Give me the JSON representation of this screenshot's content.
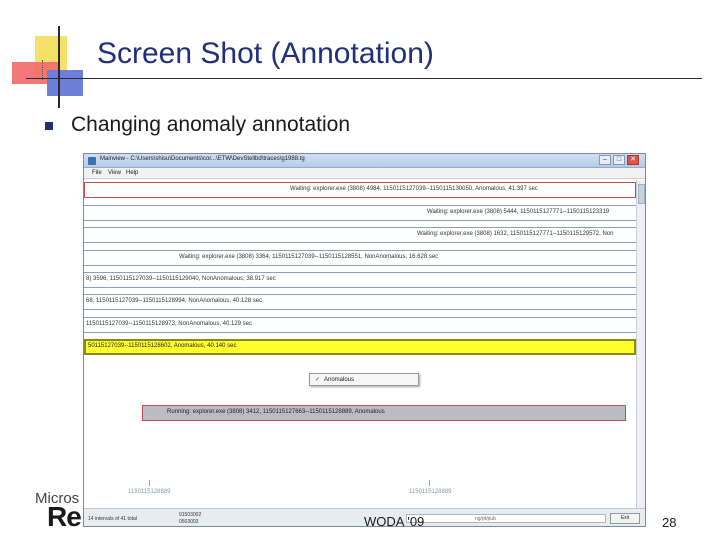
{
  "slide": {
    "title": "Screen Shot (Annotation)",
    "bullet": "Changing anomaly annotation",
    "footer": "WODA '09",
    "page_number": "28",
    "logo_line1": "Micros",
    "logo_line2": "Re"
  },
  "window": {
    "title": "Mainview - C:\\Users\\shisu\\Documents\\cor...\\ETW\\DevStellbd\\traces\\g1988.tg",
    "buttons": {
      "minimize": "–",
      "maximize": "□",
      "close": "✕"
    },
    "menu": [
      "File",
      "View",
      "Help"
    ],
    "rows": [
      {
        "text": "Waiting: explorer.exe (3808) 4984, 1150115127039--1150115130050, Anomalous, 41.397 sec"
      },
      {
        "text": "Waiting: explorer.exe (3808) 5444, 1150115127771--1150115123319"
      },
      {
        "text": "Waiting: explorer.exe (3808) 1632, 1150115127771--1150115129572, Non"
      },
      {
        "text": "Waiting: explorer.exe (3808) 3364, 1150115127039--1150115128551, NonAnomalous, 16.628 sec"
      },
      {
        "text": "8) 3596, 1150115127039--1150115129040, NonAnomalous, 38.917 sec"
      },
      {
        "text": "68, 1150115127039--1150115128994, NonAnomalous, 40.128 sec"
      },
      {
        "text": "1150115127039--1150115128973, NonAnomalous, 40.129 sec"
      },
      {
        "text": "50115127039--1150115128602, Anomalous, 40.140 sec"
      },
      {
        "text": "Running: explorer.exe (3808) 3412, 1150115127663--1150115128889, Anomalous"
      }
    ],
    "popup": {
      "check": "✓",
      "label": "Anomalous"
    },
    "axis_labels": [
      "1150115128889",
      "1150115128889"
    ],
    "status": {
      "line1_left": "14 intervals of 41 total",
      "line1_right": "91503002",
      "line2_right": "0503003",
      "field_text": "ng/pt/pub",
      "button": "Exit"
    }
  }
}
